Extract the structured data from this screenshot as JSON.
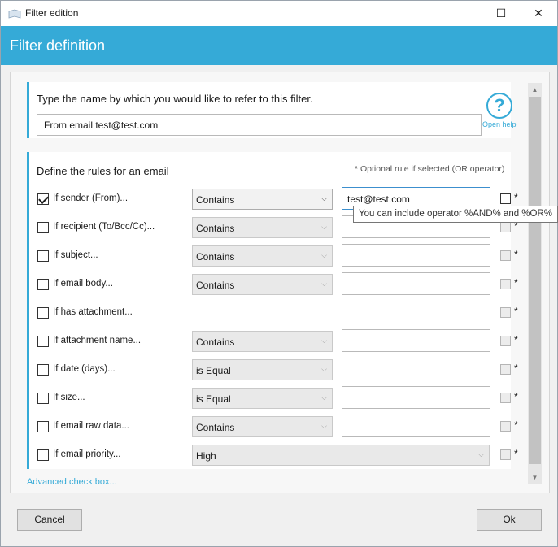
{
  "window": {
    "title": "Filter edition",
    "minimize": "—",
    "maximize": "☐",
    "close": "✕"
  },
  "header": {
    "title": "Filter definition"
  },
  "name_section": {
    "prompt": "Type the name by which you would like to refer to this filter.",
    "value": "From email test@test.com",
    "help_icon": "?",
    "help_label": "Open help"
  },
  "rules_section": {
    "title": "Define the rules for an email",
    "optional_note": "* Optional rule if selected (OR operator)",
    "rules": [
      {
        "label": "If sender (From)...",
        "checked": true,
        "operator": "Contains",
        "value": "test@test.com",
        "star": "*"
      },
      {
        "label": "If recipient (To/Bcc/Cc)...",
        "checked": false,
        "operator": "Contains",
        "value": "",
        "star": "*"
      },
      {
        "label": "If subject...",
        "checked": false,
        "operator": "Contains",
        "value": "",
        "star": "*"
      },
      {
        "label": "If email body...",
        "checked": false,
        "operator": "Contains",
        "value": "",
        "star": "*"
      },
      {
        "label": "If has attachment...",
        "checked": false,
        "operator": "",
        "value": "",
        "star": "*"
      },
      {
        "label": "If attachment name...",
        "checked": false,
        "operator": "Contains",
        "value": "",
        "star": "*"
      },
      {
        "label": "If date (days)...",
        "checked": false,
        "operator": "is Equal",
        "value": "",
        "star": "*"
      },
      {
        "label": "If size...",
        "checked": false,
        "operator": "is Equal",
        "value": "",
        "star": "*"
      },
      {
        "label": "If email raw data...",
        "checked": false,
        "operator": "Contains",
        "value": "",
        "star": "*"
      },
      {
        "label": "If email priority...",
        "checked": false,
        "operator": "High",
        "value": "",
        "star": "*"
      }
    ],
    "tooltip": "You can include operator %AND% and %OR%",
    "advanced_link": "Advanced check box..."
  },
  "footer": {
    "cancel": "Cancel",
    "ok": "Ok"
  },
  "colors": {
    "accent": "#35aad7"
  }
}
